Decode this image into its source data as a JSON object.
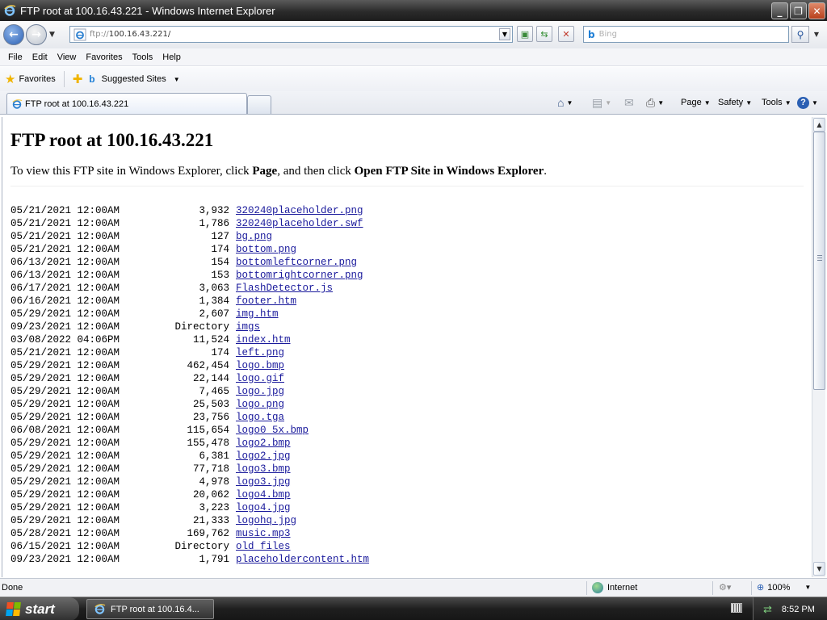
{
  "window": {
    "title": "FTP root at 100.16.43.221 - Windows Internet Explorer",
    "minimize": "_",
    "maximize": "❐",
    "close": "✕"
  },
  "address": {
    "protocol": "ftp://",
    "host": "100.16.43.221/"
  },
  "search": {
    "placeholder": "Bing"
  },
  "menu": [
    "File",
    "Edit",
    "View",
    "Favorites",
    "Tools",
    "Help"
  ],
  "favorites_bar": {
    "favorites_label": "Favorites",
    "suggested_label": "Suggested Sites"
  },
  "tab": {
    "label": "FTP root at 100.16.43.221"
  },
  "command_bar": {
    "page": "Page",
    "safety": "Safety",
    "tools": "Tools"
  },
  "page": {
    "heading": "FTP root at 100.16.43.221",
    "intro_prefix": "To view this FTP site in Windows Explorer, click ",
    "intro_page": "Page",
    "intro_middle": ", and then click ",
    "intro_open": "Open FTP Site in Windows Explorer",
    "intro_suffix": "."
  },
  "listing": [
    {
      "date": "05/21/2021 12:00AM",
      "size": "3,932",
      "name": "320240placeholder.png"
    },
    {
      "date": "05/21/2021 12:00AM",
      "size": "1,786",
      "name": "320240placeholder.swf"
    },
    {
      "date": "05/21/2021 12:00AM",
      "size": "127",
      "name": "bg.png"
    },
    {
      "date": "05/21/2021 12:00AM",
      "size": "174",
      "name": "bottom.png"
    },
    {
      "date": "06/13/2021 12:00AM",
      "size": "154",
      "name": "bottomleftcorner.png"
    },
    {
      "date": "06/13/2021 12:00AM",
      "size": "153",
      "name": "bottomrightcorner.png"
    },
    {
      "date": "06/17/2021 12:00AM",
      "size": "3,063",
      "name": "FlashDetector.js"
    },
    {
      "date": "06/16/2021 12:00AM",
      "size": "1,384",
      "name": "footer.htm"
    },
    {
      "date": "05/29/2021 12:00AM",
      "size": "2,607",
      "name": "img.htm"
    },
    {
      "date": "09/23/2021 12:00AM",
      "size": "Directory",
      "name": "imgs"
    },
    {
      "date": "03/08/2022 04:06PM",
      "size": "11,524",
      "name": "index.htm"
    },
    {
      "date": "05/21/2021 12:00AM",
      "size": "174",
      "name": "left.png"
    },
    {
      "date": "05/29/2021 12:00AM",
      "size": "462,454",
      "name": "logo.bmp"
    },
    {
      "date": "05/29/2021 12:00AM",
      "size": "22,144",
      "name": "logo.gif"
    },
    {
      "date": "05/29/2021 12:00AM",
      "size": "7,465",
      "name": "logo.jpg"
    },
    {
      "date": "05/29/2021 12:00AM",
      "size": "25,503",
      "name": "logo.png"
    },
    {
      "date": "05/29/2021 12:00AM",
      "size": "23,756",
      "name": "logo.tga"
    },
    {
      "date": "06/08/2021 12:00AM",
      "size": "115,654",
      "name": "logo0_5x.bmp"
    },
    {
      "date": "05/29/2021 12:00AM",
      "size": "155,478",
      "name": "logo2.bmp"
    },
    {
      "date": "05/29/2021 12:00AM",
      "size": "6,381",
      "name": "logo2.jpg"
    },
    {
      "date": "05/29/2021 12:00AM",
      "size": "77,718",
      "name": "logo3.bmp"
    },
    {
      "date": "05/29/2021 12:00AM",
      "size": "4,978",
      "name": "logo3.jpg"
    },
    {
      "date": "05/29/2021 12:00AM",
      "size": "20,062",
      "name": "logo4.bmp"
    },
    {
      "date": "05/29/2021 12:00AM",
      "size": "3,223",
      "name": "logo4.jpg"
    },
    {
      "date": "05/29/2021 12:00AM",
      "size": "21,333",
      "name": "logohq.jpg"
    },
    {
      "date": "05/28/2021 12:00AM",
      "size": "169,762",
      "name": "music.mp3"
    },
    {
      "date": "06/15/2021 12:00AM",
      "size": "Directory",
      "name": "old files"
    },
    {
      "date": "09/23/2021 12:00AM",
      "size": "1,791",
      "name": "placeholdercontent.htm"
    }
  ],
  "status": {
    "text": "Done",
    "zone": "Internet",
    "zoom": "100%"
  },
  "taskbar": {
    "start": "start",
    "task_label": "FTP root at 100.16.4...",
    "clock": "8:52 PM"
  },
  "colors": {
    "link": "#1a1a9c",
    "titlebar": "#2b2b2b"
  }
}
